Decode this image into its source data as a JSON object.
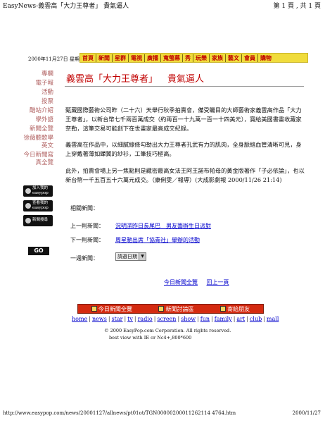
{
  "page_header": {
    "site_title": "EasyNews-義雲高「大力王尊者」 貴氣逼人",
    "page_counter": "第 1 頁 , 共 1 頁"
  },
  "date_line": "2000年11月27日 星期一",
  "nav": {
    "items": [
      "首頁",
      "新聞",
      "星群",
      "電視",
      "廣播",
      "寬螢幕",
      "秀",
      "玩樂",
      "家族",
      "藝文",
      "會員",
      "購物"
    ]
  },
  "sidebar": {
    "links": [
      "專欄",
      "電子報",
      "活動",
      "投票",
      "酷站介紹",
      "學外語",
      "新聞全覽",
      "徐薇聽歌學英文",
      "今日新聞寫真全覽"
    ],
    "buttons": [
      {
        "label": "加入我的 easypop"
      },
      {
        "label": "查看我的 easypop"
      },
      {
        "label": "新聞搜尋"
      }
    ],
    "go_label": "GO"
  },
  "article": {
    "title_main": "義雲高「大力王尊者」",
    "title_sub": "貴氣逼人",
    "p1": "甄藏國際藝術公司昨（二十六）天舉行秋季拍賣會，備受矚目的大師藝術家義雲高作品「大力王尊者」，以新台幣七千兩百萬成交（約兩百一十九萬一百一十四美元），寶給美國書畫收藏家奈勒，這筆交易可能創下在世畫家最高成交紀錄。",
    "p2": "義雲高在作品中，以細膩線條勾勒出大力王尊者孔武有力的肌肉，全身脈絡血管清晰可見，身上穿戴著薄如蟬翼的紗衫，工筆技巧極高。",
    "p3": "此外，拍賣會場上另一焦點則是藏密最高女法王阿王諾布帕母的黃金版著作「子必依論」，也以新台幣一千五百五十六萬元成交。（康俐雯／報導）(大成影劇報 2000/11/26 21:14)"
  },
  "related": {
    "heading": "相關新聞：",
    "prev_label": "上一則新聞：",
    "prev_link": "況明潔昨日長尾巴　男友籌辦生日派對",
    "next_label": "下一則新聞：",
    "next_link": "周星馳出席「協青社」舉辦的活動",
    "week_label": "一週新聞：",
    "select_value": "請選日期"
  },
  "bottom_links": [
    "今日新聞全覽",
    "回上一頁"
  ],
  "redbar": [
    "今日新聞全覽",
    "新聞討論區",
    "寄給朋友"
  ],
  "footnav": [
    "home",
    "news",
    "star",
    "tv",
    "radio",
    "screen",
    "show",
    "fun",
    "family",
    "art",
    "club",
    "mall"
  ],
  "copyright": "© 2000 EasyPop.com Corporation. All rights reserved.",
  "best_view": "best view with IE or Nc4+,800*600",
  "footer_url": "http://www.easypop.com/news/20001127/allnews/pt01ot/TGN00000200011262114 4764.htm",
  "footer_date": "2000/11/27"
}
